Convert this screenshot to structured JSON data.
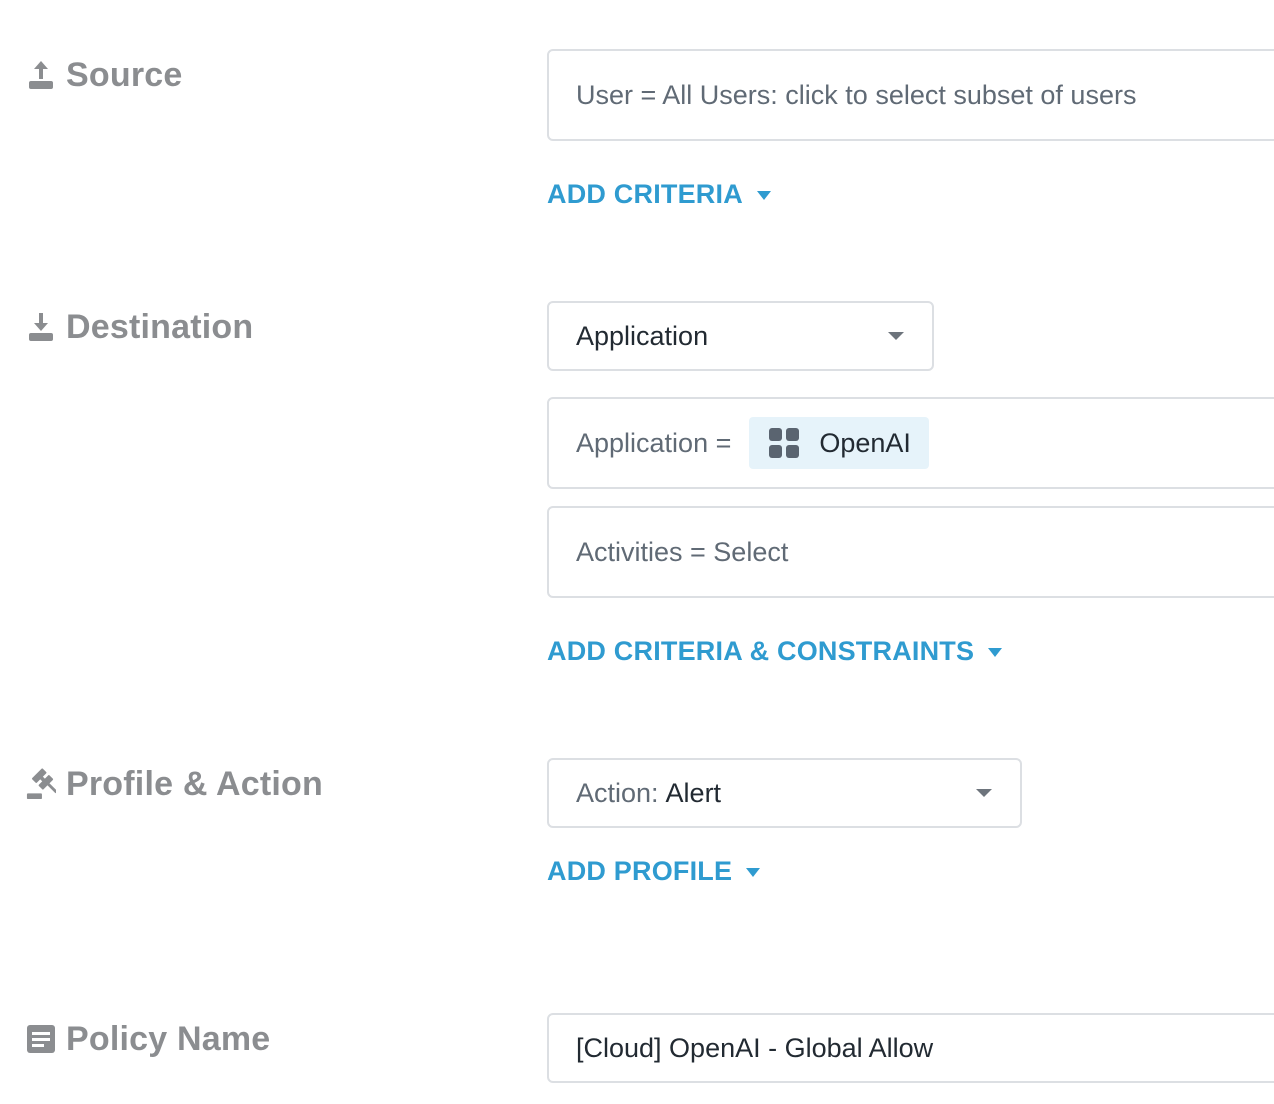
{
  "source": {
    "label": "Source",
    "icon": "upload-icon",
    "user_field": "User = All Users: click to select subset of users",
    "add_criteria": "ADD CRITERIA"
  },
  "destination": {
    "label": "Destination",
    "icon": "download-icon",
    "type_select": "Application",
    "application_prefix": "Application =",
    "application_chip": "OpenAI",
    "application_chip_icon": "app-grid-icon",
    "activities_field": "Activities = Select",
    "add_criteria_constraints": "ADD CRITERIA & CONSTRAINTS"
  },
  "profile_action": {
    "label": "Profile & Action",
    "icon": "gavel-icon",
    "action_prefix": "Action:",
    "action_value": "Alert",
    "add_profile": "ADD PROFILE"
  },
  "policy_name": {
    "label": "Policy Name",
    "icon": "document-icon",
    "value": "[Cloud] OpenAI - Global Allow"
  },
  "colors": {
    "label_gray": "#8b8d90",
    "link_blue": "#2f9bd0",
    "border": "#dcdfe3",
    "chip_bg": "#e6f3fa"
  }
}
